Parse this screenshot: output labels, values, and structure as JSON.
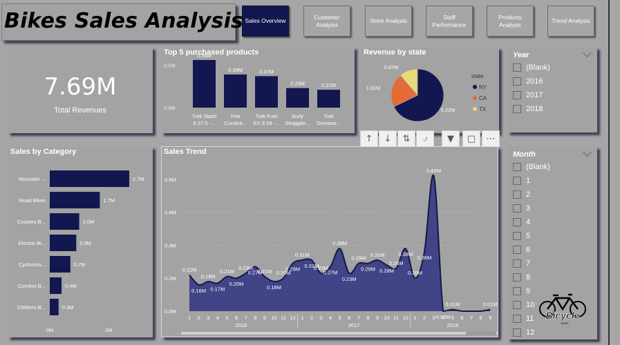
{
  "header": {
    "title": "Bikes Sales Analysis"
  },
  "nav": [
    {
      "label": "Sales Overview",
      "active": true
    },
    {
      "label": "Customer Analysis",
      "active": false
    },
    {
      "label": "Store Analysis",
      "active": false
    },
    {
      "label": "Staff Performance",
      "active": false
    },
    {
      "label": "Products Analysis",
      "active": false
    },
    {
      "label": "Trend Analysis",
      "active": false
    }
  ],
  "kpi": {
    "value": "7.69M",
    "label": "Total Revenues"
  },
  "toolbar": [
    "arrow-up-icon",
    "arrow-down-icon",
    "expand-level-icon",
    "drill-icon",
    "filter-icon",
    "focus-mode-icon",
    "more-options-icon"
  ],
  "year_slicer": {
    "title": "Year",
    "items": [
      "(Blank)",
      "2016",
      "2017",
      "2018"
    ]
  },
  "month_slicer": {
    "title": "Month",
    "items": [
      "(Blank)",
      "1",
      "2",
      "3",
      "4",
      "5",
      "6",
      "7",
      "8",
      "9",
      "10",
      "11",
      "12"
    ]
  },
  "logo": {
    "text": "Bicycle",
    "subtext": "SHOP"
  },
  "colors": {
    "navy": "#13174f",
    "area": "#3c3f86",
    "ca": "#e46b35",
    "tx": "#ead97a",
    "ny": "#13174f"
  },
  "chart_data": [
    {
      "id": "top5",
      "type": "bar",
      "title": "Top 5 purchased products",
      "categories": [
        [
          "Trek Slash",
          "8 27.5 -..."
        ],
        [
          "Trek",
          "Conduit..."
        ],
        [
          "Trek Fuel",
          "EX 8 29 -..."
        ],
        [
          "Surly",
          "Straggler..."
        ],
        [
          "Trek",
          "Domane..."
        ]
      ],
      "values": [
        0.56,
        0.39,
        0.37,
        0.23,
        0.21
      ],
      "labels": [
        "0.56M",
        "0.39M",
        "0.37M",
        "0.23M",
        "0.21M"
      ],
      "yticks": [
        "0.0M",
        "0.5M"
      ],
      "ylim": [
        0,
        0.6
      ]
    },
    {
      "id": "state",
      "type": "pie",
      "title": "Revenue by state",
      "legend_title": "state",
      "slices": [
        {
          "name": "NY",
          "value": 5.22,
          "label": "5.22M",
          "color": "#13174f"
        },
        {
          "name": "CA",
          "value": 1.61,
          "label": "1.61M",
          "color": "#e46b35"
        },
        {
          "name": "TX",
          "value": 0.87,
          "label": "0.87M",
          "color": "#ead97a"
        }
      ]
    },
    {
      "id": "category",
      "type": "bar",
      "orientation": "horizontal",
      "title": "Sales by Category",
      "categories": [
        "Mountain ...",
        "Road Bikes",
        "Cruisers B...",
        "Electric Bi...",
        "Cyclocros...",
        "Comfort B...",
        "Children B..."
      ],
      "values": [
        2.7,
        1.7,
        1.0,
        0.9,
        0.7,
        0.4,
        0.3
      ],
      "labels": [
        "2.7M",
        "1.7M",
        "1.0M",
        "0.9M",
        "0.7M",
        "0.4M",
        "0.3M"
      ],
      "xticks": [
        "0M",
        "2M"
      ],
      "xlim": [
        0,
        3.2
      ]
    },
    {
      "id": "trend",
      "type": "area",
      "title": "Sales Trend",
      "yticks": [
        "0.0M",
        "0.2M",
        "0.4M",
        "0.6M",
        "0.8M"
      ],
      "ylim": [
        0,
        0.9
      ],
      "months": [
        "1",
        "2",
        "3",
        "4",
        "5",
        "6",
        "7",
        "8",
        "9",
        "10",
        "11",
        "12",
        "1",
        "2",
        "3",
        "4",
        "5",
        "6",
        "7",
        "8",
        "9",
        "10",
        "11",
        "12",
        "1",
        "2",
        "3",
        "4",
        "5",
        "6",
        "7",
        "8",
        "9"
      ],
      "years": [
        "2016",
        "2017",
        "2018"
      ],
      "values": [
        0.22,
        0.16,
        0.18,
        0.17,
        0.21,
        0.2,
        0.23,
        0.27,
        0.21,
        0.18,
        0.2,
        0.29,
        0.31,
        0.31,
        0.23,
        0.27,
        0.38,
        0.23,
        0.29,
        0.29,
        0.31,
        0.28,
        0.26,
        0.38,
        0.2,
        0.36,
        0.82,
        0.0,
        0.01,
        0.0,
        0.0,
        0.0,
        0.01
      ],
      "labels": [
        "0.22M",
        "0.16M",
        "0.18M",
        "0.17M",
        "0.21M",
        "0.20M",
        "0.23M",
        "0.27M",
        "0.21M",
        "0.18M",
        "0.20M",
        "0.29M",
        "0.31M",
        "0.31M",
        "0.23M",
        "0.27M",
        "0.38M",
        "0.23M",
        "0.29M",
        "0.29M",
        "0.31M",
        "0.28M",
        "0.26M",
        "0.38M",
        "0.20M",
        "0.36M",
        "0.82M",
        "0.00M",
        "0.01M",
        "",
        "",
        "",
        "0.01M"
      ]
    }
  ]
}
